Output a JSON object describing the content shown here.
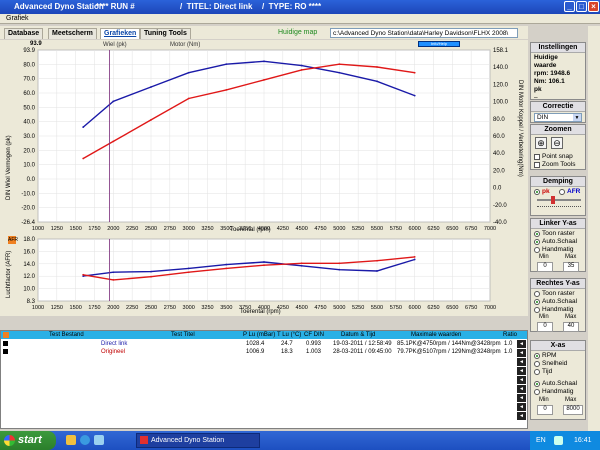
{
  "window": {
    "title_app": "Advanced Dyno Station",
    "title_run": "**** RUN #",
    "title_titel": "/  TITEL: Direct link",
    "title_type": "/  TYPE: RO ****"
  },
  "menu": {
    "item": "Grafiek"
  },
  "tabs": [
    {
      "label": "Database"
    },
    {
      "label": "Meetscherm"
    },
    {
      "label": "Grafieken"
    },
    {
      "label": "Tuning Tools"
    }
  ],
  "toolbar": {
    "map_label": "Huidige map",
    "path_value": "c:\\Advanced Dyno Station\\data\\Harley Davidson\\FLHX 2008\\"
  },
  "graph": {
    "legend_wiel": "Wiel (pk)",
    "legend_motor": "Motor (Nm)",
    "right_button": "Info/Help",
    "y_left_label": "DIN Wiel Vermogen (pk)",
    "y_right_label": "DIN Motor Koppel / Verbetering(Nm)",
    "x_label": "Toerental (rpm)",
    "afr_label": "Luchtfactor (AFR)",
    "afr_tag": "AFR",
    "curve_colors": {
      "current": "#1a1aa8",
      "original": "#e01818"
    }
  },
  "chart_data": [
    {
      "type": "line",
      "x_ticks": [
        1000,
        1250,
        1500,
        1750,
        2000,
        2250,
        2500,
        2750,
        3000,
        3250,
        3500,
        3750,
        4000,
        4250,
        4500,
        4750,
        5000,
        5250,
        5500,
        5750,
        6000,
        6250,
        6500,
        6750,
        7000
      ],
      "x": [
        1600,
        2000,
        2500,
        3000,
        3500,
        4000,
        4500,
        5000,
        5500,
        6000
      ],
      "y_left_ticks": [
        "93.9",
        "80.0",
        "70.0",
        "60.0",
        "50.0",
        "40.0",
        "30.0",
        "20.0",
        "10.0",
        "0.0",
        "-10.0",
        "-20.0",
        "-26.4"
      ],
      "y_right_ticks": [
        "158.1",
        "140.0",
        "120.0",
        "100.0",
        "80.0",
        "60.0",
        "40.0",
        "20.0",
        "0.0",
        "-20.0",
        "-40.0"
      ],
      "ylim_left": [
        -26.4,
        93.9
      ],
      "series": [
        {
          "name": "Direct link",
          "color": "#1a1aa8",
          "values": [
            40,
            58,
            68,
            78,
            84,
            86,
            83,
            78,
            72,
            62
          ]
        },
        {
          "name": "Origineel",
          "color": "#e01818",
          "values": [
            18,
            30,
            45,
            60,
            66,
            73,
            80,
            84,
            82,
            78
          ]
        }
      ]
    },
    {
      "type": "line",
      "x": [
        1600,
        2000,
        2500,
        3000,
        3500,
        4000,
        4500,
        5000,
        5500,
        6000
      ],
      "y_ticks": [
        "18.0",
        "16.0",
        "14.0",
        "12.0",
        "10.0",
        "8.3"
      ],
      "ylim": [
        8.3,
        18.0
      ],
      "series": [
        {
          "name": "Direct link",
          "color": "#1a1aa8",
          "values": [
            12.2,
            12.8,
            12.9,
            13.4,
            14.0,
            14.4,
            13.8,
            13.2,
            13.0,
            14.8
          ]
        },
        {
          "name": "Origineel",
          "color": "#e01818",
          "values": [
            12.4,
            11.6,
            12.1,
            12.8,
            13.4,
            13.9,
            14.2,
            14.2,
            14.6,
            15.2
          ]
        }
      ]
    }
  ],
  "sidebar": {
    "instellingen_head": "Instellingen",
    "huidige_waarde": "Huidige waarde",
    "rpm": "rpm: 1948.6",
    "nm": "Nm: 106.1",
    "pk": "pk",
    "correctie_head": "Correctie",
    "correctie_value": "DIN",
    "zoom_head": "Zoomen",
    "point_snap": "Point snap",
    "zoom_tools": "Zoom Tools",
    "demping_head": "Demping",
    "afr": "AFR",
    "linker_head": "Linker Y-as",
    "toon_raster": "Toon raster",
    "auto_schaal": "Auto.Schaal",
    "handmatig": "Handmatig",
    "min_label": "Min",
    "max_label": "Max",
    "linker_min": "0",
    "linker_max": "35",
    "rechter_head": "Rechtes Y-as",
    "rechter_min": "0",
    "rechter_max": "40",
    "xas_head": "X-as",
    "rpm_opt": "RPM",
    "snelheid": "Snelheid",
    "tijd": "Tijd",
    "xas_min": "0",
    "xas_max": "8000"
  },
  "table": {
    "headers": [
      "Test Bestand",
      "Test Titel",
      "P Lu (mBar)",
      "T Lu (°C)",
      "CF DIN",
      "Datum & Tijd",
      "Maximale waarden",
      "Ratio"
    ],
    "rows": [
      {
        "bestand": "",
        "titel": "Direct link",
        "plu": "1028.4",
        "tlu": "24.7",
        "cf": "0.993",
        "datum": "19-03-2011 / 12:58:49",
        "max": "85.1PK@4750rpm / 144Nm@3428rpm",
        "ratio": "1.0"
      },
      {
        "bestand": "",
        "titel": "Origineel",
        "plu": "1006.9",
        "tlu": "18.3",
        "cf": "1.003",
        "datum": "28-03-2011 / 09:45:00",
        "max": "79.7PK@5107rpm / 129Nm@3248rpm",
        "ratio": "1.0"
      }
    ]
  },
  "taskbar": {
    "start": "start",
    "task_item": "Advanced Dyno Station",
    "lang": "EN",
    "time": "16:41"
  }
}
